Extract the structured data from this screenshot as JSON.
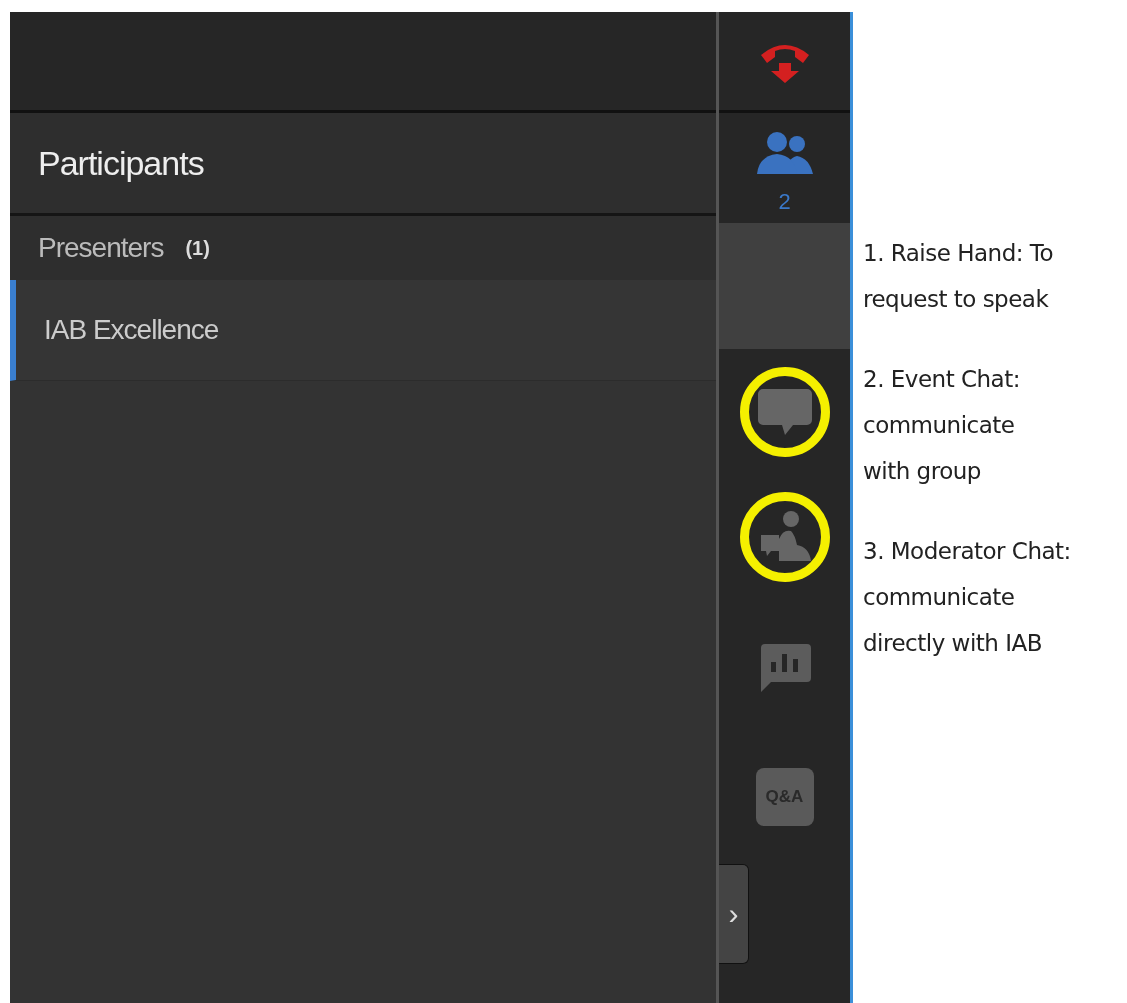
{
  "panel": {
    "title": "Participants",
    "groups": [
      {
        "label": "Presenters",
        "count": "(1)",
        "members": [
          {
            "name": "IAB Excellence",
            "selected": true
          }
        ]
      }
    ]
  },
  "rail": {
    "items": [
      {
        "kind": "hangup",
        "highlighted": false
      },
      {
        "kind": "participants",
        "badge": "2",
        "highlighted": false
      },
      {
        "kind": "raise-hand-slot",
        "highlighted": false
      },
      {
        "kind": "event-chat",
        "highlighted": true
      },
      {
        "kind": "moderator-chat",
        "highlighted": true
      },
      {
        "kind": "poll",
        "highlighted": false
      },
      {
        "kind": "qa",
        "label": "Q&A",
        "highlighted": false
      }
    ],
    "collapse": {
      "label": "›"
    }
  },
  "annotations": [
    {
      "lines": [
        "1. Raise Hand: To",
        "request to speak"
      ]
    },
    {
      "lines": [
        "2. Event Chat:",
        "communicate",
        "with group"
      ]
    },
    {
      "lines": [
        "3. Moderator Chat:",
        "communicate",
        "directly with IAB"
      ]
    }
  ]
}
